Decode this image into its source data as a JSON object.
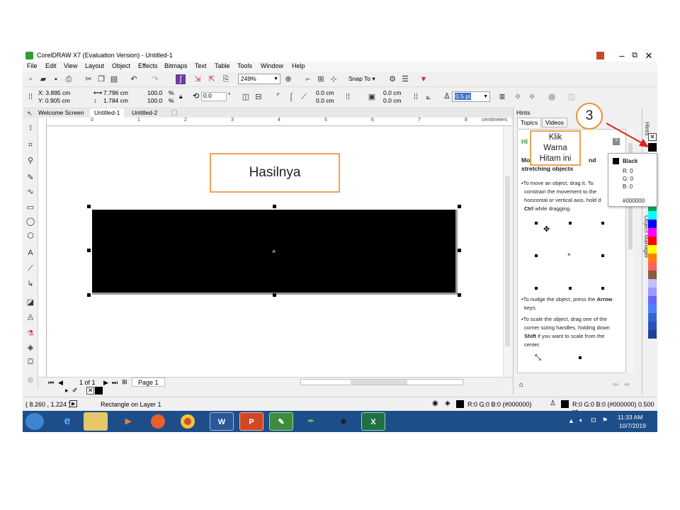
{
  "window": {
    "title": "CorelDRAW X7 (Evaluation Version) - Untitled-1",
    "controls": {
      "minimize": "‒",
      "restore": "⧉",
      "close": "✕"
    }
  },
  "menu": [
    "File",
    "Edit",
    "View",
    "Layout",
    "Object",
    "Effects",
    "Bitmaps",
    "Text",
    "Table",
    "Tools",
    "Window",
    "Help"
  ],
  "toolbar": {
    "zoom_value": "249%",
    "snap_to_label": "Snap To"
  },
  "property_bar": {
    "x_value": "X: 3.895 cm",
    "y_value": "Y: 0.905 cm",
    "width_value": "7.796 cm",
    "height_value": "1.784 cm",
    "scale_w": "100.0",
    "scale_h": "100.0",
    "percent": "%",
    "rotation": "0.0",
    "degree": "°",
    "corner_1": "0.0 cm",
    "corner_2": "0.0 cm",
    "corner_3": "0.0 cm",
    "corner_4": "0.0 cm",
    "outline_width": "0.5 pt"
  },
  "doc_tabs": [
    "Welcome Screen",
    "Untitled-1",
    "Untitled-2"
  ],
  "ruler": {
    "ticks": [
      "0",
      "1",
      "2",
      "3",
      "4",
      "5",
      "6",
      "7",
      "8"
    ],
    "unit": "centimeters"
  },
  "pager": {
    "page_count": "1 of 1",
    "page_tab": "Page 1"
  },
  "hints": {
    "title": "Hints",
    "tabs": [
      "Topics",
      "Videos"
    ],
    "heading_prefix": "HI",
    "topic_title": "Moving and stretching objects",
    "topic_title_part1": "Mo",
    "topic_title_part2": "nd",
    "topic_title_line2": "stretching objects",
    "para1_l1": "•To move an object, drag it. To",
    "para1_l2": "constrain the movement to the",
    "para1_l3": "horizontal or vertical axis, hold d",
    "para1_l4_bold": "Ctrl",
    "para1_l4_rest": " while dragging.",
    "para2_l1_a": "•To nudge the object, press the ",
    "para2_l1_bold": "Arrow",
    "para2_l2": "keys.",
    "para3_l1": "•To scale the object, drag one of the",
    "para3_l2": "corner sizing handles, holding down",
    "para3_l3_bold": "Shift",
    "para3_l3_rest": " if you want to scale from the",
    "para3_l4": "center."
  },
  "dockers": {
    "hints_label": "Hints",
    "object_manager_label": "Object Manager"
  },
  "color_tooltip": {
    "name": "Black",
    "r": "R: 0",
    "g": "G: 0",
    "b": "B: 0",
    "hex": "#000000"
  },
  "status": {
    "coords": "( 8.260 , 1.224 )",
    "object_info": "Rectangle on Layer 1",
    "fill_info": "R:0 G:0 B:0 (#000000)",
    "outline_info": "R:0 G:0 B:0 (#000000)  0.500 pt"
  },
  "taskbar": {
    "apps": [
      "start",
      "internet-explorer",
      "file-explorer",
      "media-player",
      "firefox",
      "chrome",
      "word",
      "powerpoint",
      "coreldraw",
      "corel-photo-paint",
      "corel-capture",
      "excel"
    ],
    "time": "11:33 AM",
    "date": "10/7/2019"
  },
  "annotations": {
    "result_label": "Hasilnya",
    "step_number": "3",
    "instruction_l1": "Klik",
    "instruction_l2": "Warna",
    "instruction_l3": "Hitam ini"
  },
  "colors": {
    "rectangle_fill": "#000000",
    "callout_border": "#f0a050",
    "arrow": "#e02020",
    "taskbar": "#1d4e8a"
  },
  "palette": [
    "#000000",
    "#ffffff",
    "#e6e6e6",
    "#cccccc",
    "#b3b3b3",
    "#999999",
    "#00ff00",
    "#00aa44",
    "#00ffff",
    "#0000ff",
    "#ff00ff",
    "#ff0000",
    "#ffff00",
    "#ff8000",
    "#ff6060",
    "#8b5a3c",
    "#c0c0ff",
    "#9999ff",
    "#6666ff",
    "#4d7fff",
    "#3366cc",
    "#2a4fbf",
    "#1f3f9f"
  ]
}
